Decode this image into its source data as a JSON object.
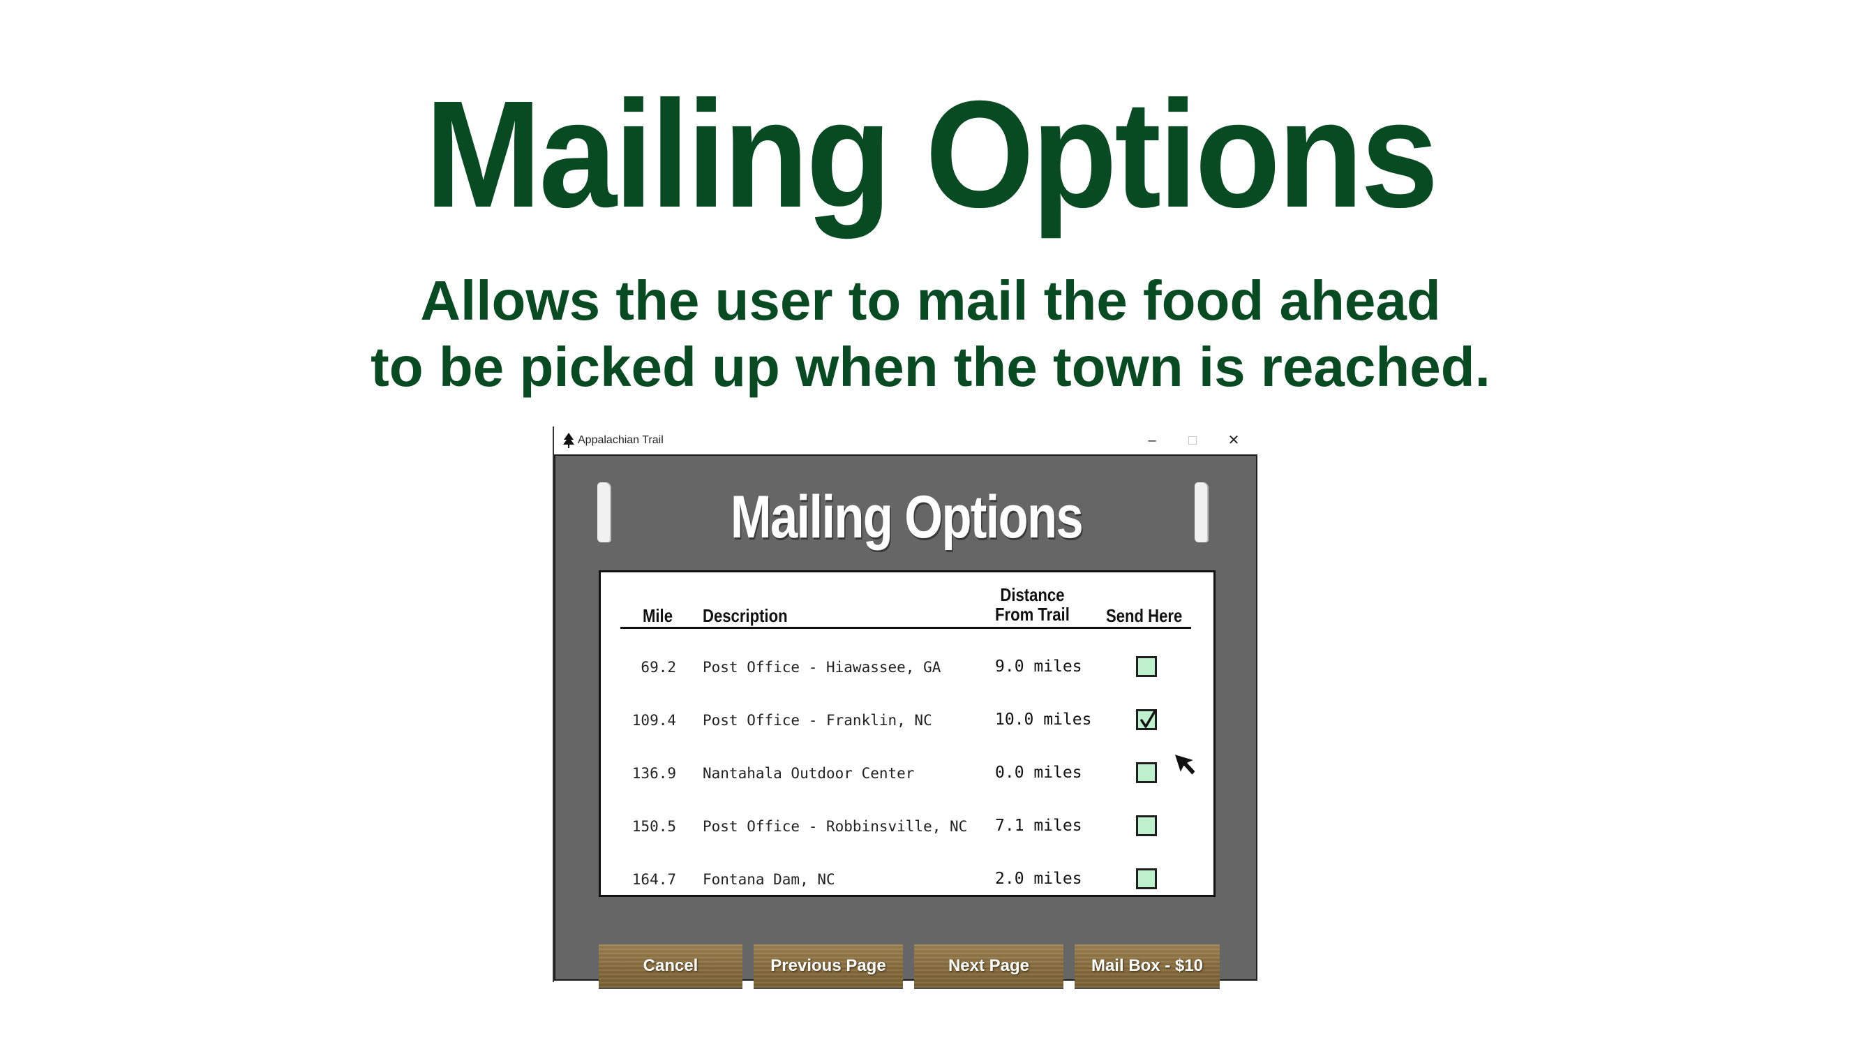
{
  "slide": {
    "title": "Mailing Options",
    "subtitle_lines": [
      "Allows the user to mail the food ahead",
      "to be picked up when the town is reached."
    ]
  },
  "window": {
    "title": "Appalachian Trail",
    "icon": "tree-icon",
    "controls": {
      "minimize": "–",
      "maximize": "□",
      "close": "✕"
    }
  },
  "panel": {
    "title": "Mailing Options",
    "columns": {
      "mile": "Mile",
      "description": "Description",
      "distance_line1": "Distance",
      "distance_line2": "From Trail",
      "send_here": "Send Here"
    },
    "rows": [
      {
        "mile": "69.2",
        "description": "Post Office - Hiawassee, GA",
        "distance": "9.0 miles",
        "checked": false
      },
      {
        "mile": "109.4",
        "description": "Post Office - Franklin, NC",
        "distance": "10.0 miles",
        "checked": true
      },
      {
        "mile": "136.9",
        "description": "Nantahala Outdoor Center",
        "distance": "0.0 miles",
        "checked": false
      },
      {
        "mile": "150.5",
        "description": "Post Office - Robbinsville, NC",
        "distance": "7.1 miles",
        "checked": false
      },
      {
        "mile": "164.7",
        "description": "Fontana Dam, NC",
        "distance": "2.0 miles",
        "checked": false
      }
    ],
    "buttons": {
      "cancel": "Cancel",
      "previous": "Previous Page",
      "next": "Next Page",
      "mailbox": "Mail Box - $10"
    }
  },
  "colors": {
    "heading_green": "#084a22",
    "panel_gray": "#666666",
    "checkbox_fill": "#bff0cd",
    "wood": "#8c7344"
  }
}
